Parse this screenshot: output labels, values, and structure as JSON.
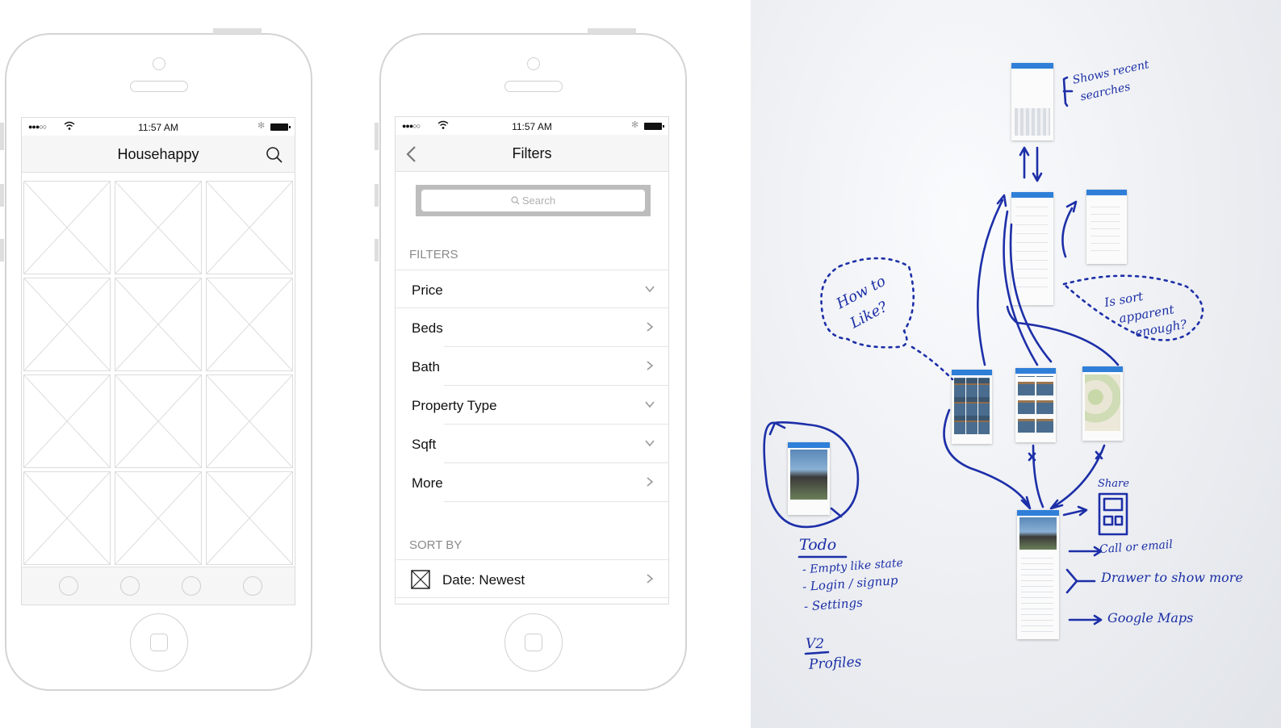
{
  "phone_left": {
    "status": {
      "signal": "●●●○○",
      "time": "11:57 AM",
      "bluetooth": "✻"
    },
    "nav": {
      "title": "Househappy",
      "search_icon": "search-icon"
    },
    "grid": {
      "rows": 4,
      "cols": 3,
      "placeholder_icon": "image-placeholder-icon"
    },
    "tabs": [
      "tab-1",
      "tab-2",
      "tab-3",
      "tab-4"
    ]
  },
  "phone_right": {
    "status": {
      "signal": "●●●○○",
      "time": "11:57 AM",
      "bluetooth": "✻"
    },
    "nav": {
      "title": "Filters",
      "back_icon": "back-chevron-icon"
    },
    "search": {
      "placeholder": "Search",
      "icon": "search-icon"
    },
    "filters": {
      "heading": "FILTERS",
      "items": [
        {
          "label": "Price",
          "indicator": "chevron-down-icon"
        },
        {
          "label": "Beds",
          "indicator": "chevron-right-icon"
        },
        {
          "label": "Bath",
          "indicator": "chevron-right-icon"
        },
        {
          "label": "Property Type",
          "indicator": "chevron-down-icon"
        },
        {
          "label": "Sqft",
          "indicator": "chevron-down-icon"
        },
        {
          "label": "More",
          "indicator": "chevron-right-icon"
        }
      ]
    },
    "sort": {
      "heading": "SORT BY",
      "item": {
        "label": "Date: Newest",
        "indicator": "chevron-right-icon",
        "icon": "checkbox-icon"
      }
    }
  },
  "whiteboard": {
    "notes": {
      "recent": [
        "Shows recent",
        "searches"
      ],
      "how_to": [
        "How to",
        "Like?"
      ],
      "sort_q": [
        "Is sort",
        "apparent",
        "enough?"
      ],
      "share": "Share",
      "call": "Call  or email",
      "drawer": "Drawer to show more",
      "maps": "Google Maps",
      "todo_title": "Todo",
      "todo_items": [
        "- Empty like state",
        "- Login / signup",
        "- Settings"
      ],
      "v2": "V2",
      "profiles": "Profiles"
    },
    "colors": {
      "ink": "#1d2fa8",
      "card_header": "#2f7fd8"
    }
  }
}
